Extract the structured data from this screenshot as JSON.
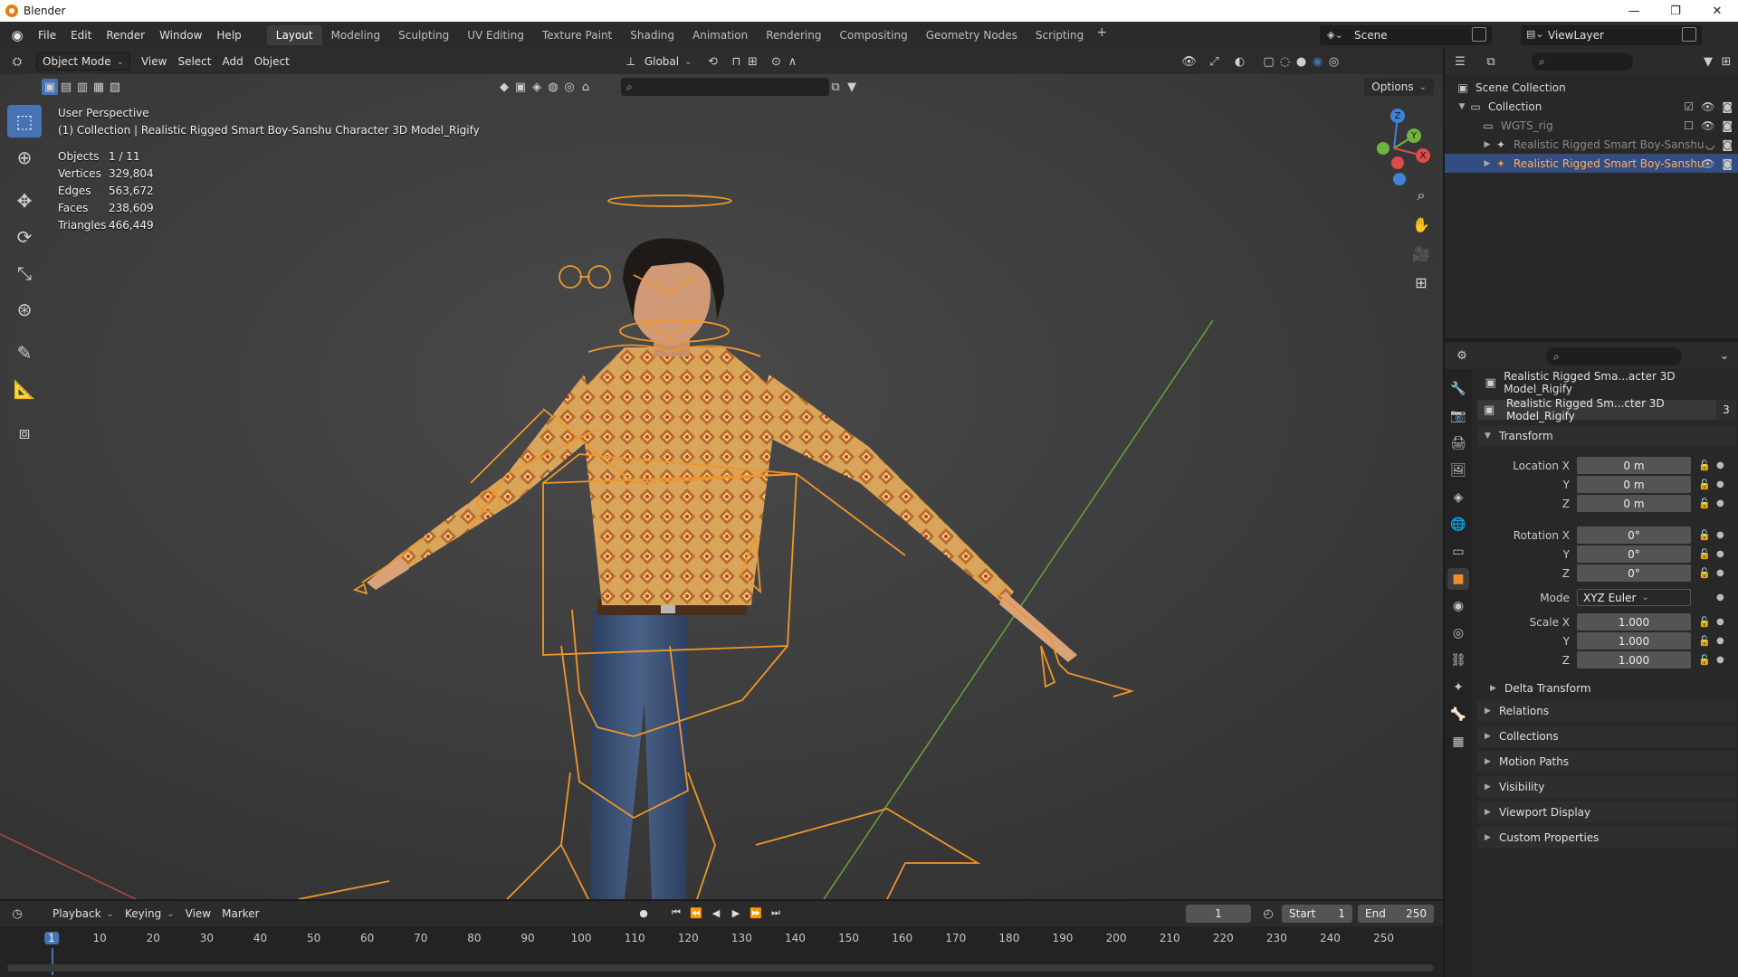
{
  "window": {
    "title": "Blender"
  },
  "menu": [
    "File",
    "Edit",
    "Render",
    "Window",
    "Help"
  ],
  "workspaces": [
    "Layout",
    "Modeling",
    "Sculpting",
    "UV Editing",
    "Texture Paint",
    "Shading",
    "Animation",
    "Rendering",
    "Compositing",
    "Geometry Nodes",
    "Scripting"
  ],
  "scene": "Scene",
  "view_layer": "ViewLayer",
  "viewport": {
    "mode": "Object Mode",
    "menus": [
      "View",
      "Select",
      "Add",
      "Object"
    ],
    "orientation": "Global",
    "options_label": "Options",
    "perspective": "User Perspective",
    "collection_line": "(1) Collection | Realistic Rigged Smart Boy-Sanshu Character 3D Model_Rigify",
    "stats": [
      {
        "k": "Objects",
        "v": "1 / 11"
      },
      {
        "k": "Vertices",
        "v": "329,804"
      },
      {
        "k": "Edges",
        "v": "563,672"
      },
      {
        "k": "Faces",
        "v": "238,609"
      },
      {
        "k": "Triangles",
        "v": "466,449"
      }
    ],
    "gizmo": {
      "z": "Z",
      "y": "Y",
      "x": "X"
    }
  },
  "outliner": {
    "root": "Scene Collection",
    "collection": "Collection",
    "items": [
      {
        "label": "WGTS_rig"
      },
      {
        "label": "Realistic Rigged Smart Boy-Sanshu"
      },
      {
        "label": "Realistic Rigged Smart Boy-Sanshu"
      }
    ]
  },
  "properties": {
    "object_title": "Realistic Rigged Sma...acter 3D Model_Rigify",
    "object_name": "Realistic Rigged Sm...cter 3D Model_Rigify",
    "users": "3",
    "transform_label": "Transform",
    "location": {
      "label": "Location X",
      "x": "0 m",
      "y": "0 m",
      "z": "0 m"
    },
    "rotation": {
      "label": "Rotation X",
      "x": "0°",
      "y": "0°",
      "z": "0°"
    },
    "mode_label": "Mode",
    "mode_value": "XYZ Euler",
    "scale": {
      "label": "Scale X",
      "x": "1.000",
      "y": "1.000",
      "z": "1.000"
    },
    "axis_y": "Y",
    "axis_z": "Z",
    "delta": "Delta Transform",
    "panels": [
      "Relations",
      "Collections",
      "Motion Paths",
      "Visibility",
      "Viewport Display",
      "Custom Properties"
    ]
  },
  "timeline": {
    "menus": [
      "Playback",
      "Keying",
      "View",
      "Marker"
    ],
    "current_frame": "1",
    "start_label": "Start",
    "start": "1",
    "end_label": "End",
    "end": "250",
    "ticks": [
      "1",
      "10",
      "20",
      "30",
      "40",
      "50",
      "60",
      "70",
      "80",
      "90",
      "100",
      "110",
      "120",
      "130",
      "140",
      "150",
      "160",
      "170",
      "180",
      "190",
      "200",
      "210",
      "220",
      "230",
      "240",
      "250"
    ]
  },
  "colors": {
    "accent": "#4772b3",
    "selection": "#334d80",
    "rig": "#f0962a",
    "x_axis": "#e04a4a",
    "y_axis": "#6fb33d",
    "z_axis": "#3f82d6"
  }
}
